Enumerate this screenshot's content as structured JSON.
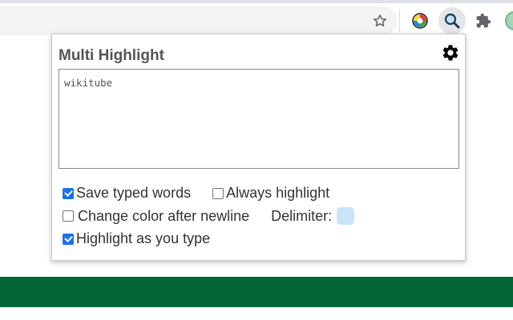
{
  "browser": {
    "icons": [
      "star-icon",
      "color-wheel-extension-icon",
      "magnifier-extension-icon",
      "puzzle-extensions-icon"
    ]
  },
  "popup": {
    "title": "Multi Highlight",
    "settings_icon": "gear-icon",
    "words_value": "wikitube",
    "options": {
      "save_typed": {
        "label": "Save typed words",
        "checked": true
      },
      "always_highlight": {
        "label": "Always highlight",
        "checked": false
      },
      "change_color": {
        "label": "Change color after newline",
        "checked": false
      },
      "delimiter": {
        "label": "Delimiter:",
        "color": "#c8e6fa"
      },
      "highlight_as_type": {
        "label": "Highlight as you type",
        "checked": true
      }
    }
  },
  "colors": {
    "green_band": "#036634",
    "checkbox_accent": "#1a73e8"
  }
}
